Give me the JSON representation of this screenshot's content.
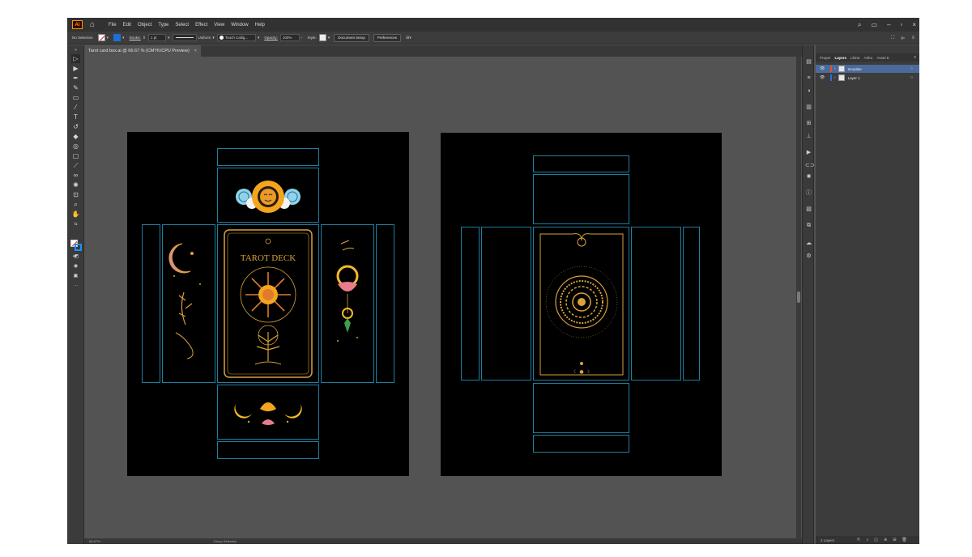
{
  "menubar": {
    "logo": "Ai",
    "items": [
      "File",
      "Edit",
      "Object",
      "Type",
      "Select",
      "Effect",
      "View",
      "Window",
      "Help"
    ]
  },
  "controlbar": {
    "selection": "No Selection",
    "stroke_label": "Stroke:",
    "stroke_weight": "1 pt",
    "profile": "Uniform",
    "brush": "Touch Callig...",
    "opacity_label": "Opacity:",
    "opacity_value": "100%",
    "style_label": "Style:",
    "doc_setup": "Document Setup",
    "preferences": "Preferences"
  },
  "tab": {
    "title": "Tarot card box.ai @ 66.67 % (CMYK/CPU Preview)",
    "close": "×"
  },
  "layers_panel": {
    "tabs": [
      "Proper",
      "Layers",
      "Librar",
      "Artbo",
      "Asset E"
    ],
    "active_tab": "Layers",
    "layers": [
      {
        "name": "template",
        "color": "#e0522d",
        "selected": true
      },
      {
        "name": "Layer 1",
        "color": "#3a6ad8",
        "selected": false
      }
    ],
    "count": "2 Layers"
  },
  "statusbar": {
    "zoom": "66.67%",
    "tool": "Group Selection"
  },
  "colors": {
    "app_bg": "#535353",
    "artboard": "#000000",
    "guide": "#1f7f9f",
    "gold": "#d9a23a"
  }
}
